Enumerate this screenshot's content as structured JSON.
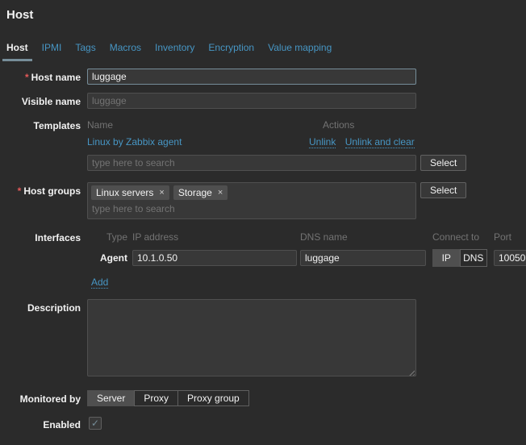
{
  "window": {
    "title": "Host"
  },
  "tabs": [
    {
      "label": "Host",
      "active": true
    },
    {
      "label": "IPMI"
    },
    {
      "label": "Tags"
    },
    {
      "label": "Macros"
    },
    {
      "label": "Inventory"
    },
    {
      "label": "Encryption"
    },
    {
      "label": "Value mapping"
    }
  ],
  "form": {
    "required_marker": "*",
    "host_name": {
      "label": "Host name",
      "value": "luggage"
    },
    "visible_name": {
      "label": "Visible name",
      "placeholder": "luggage"
    },
    "templates": {
      "label": "Templates",
      "name_column": "Name",
      "actions_column": "Actions",
      "linked": [
        {
          "name": "Linux by Zabbix agent",
          "unlink": "Unlink",
          "unlink_and_clear": "Unlink and clear"
        }
      ],
      "search_placeholder": "type here to search",
      "select_button": "Select"
    },
    "host_groups": {
      "label": "Host groups",
      "chips": [
        {
          "label": "Linux servers"
        },
        {
          "label": "Storage"
        }
      ],
      "remove_icon": "×",
      "search_placeholder": "type here to search",
      "select_button": "Select"
    },
    "interfaces": {
      "label": "Interfaces",
      "columns": {
        "type": "Type",
        "ip": "IP address",
        "dns": "DNS name",
        "connect": "Connect to",
        "port": "Port"
      },
      "rows": [
        {
          "type": "Agent",
          "ip": "10.1.0.50",
          "dns": "luggage",
          "connect_ip": "IP",
          "connect_dns": "DNS",
          "connect_selected": "IP",
          "port": "10050"
        }
      ],
      "add_link": "Add"
    },
    "description": {
      "label": "Description",
      "value": ""
    },
    "monitored_by": {
      "label": "Monitored by",
      "options": [
        {
          "label": "Server",
          "selected": true
        },
        {
          "label": "Proxy",
          "selected": false
        },
        {
          "label": "Proxy group",
          "selected": false
        }
      ]
    },
    "enabled": {
      "label": "Enabled",
      "checked": true,
      "check_icon": "✓"
    }
  },
  "colors": {
    "background": "#2b2b2b",
    "text": "#f2f2f2",
    "muted_text": "#737373",
    "link": "#4796c4",
    "border": "#4f4f4f",
    "input_background": "#383838",
    "focus_border": "#768d99",
    "required_marker": "#e45959",
    "selected_segment": "#4f4f4f"
  }
}
